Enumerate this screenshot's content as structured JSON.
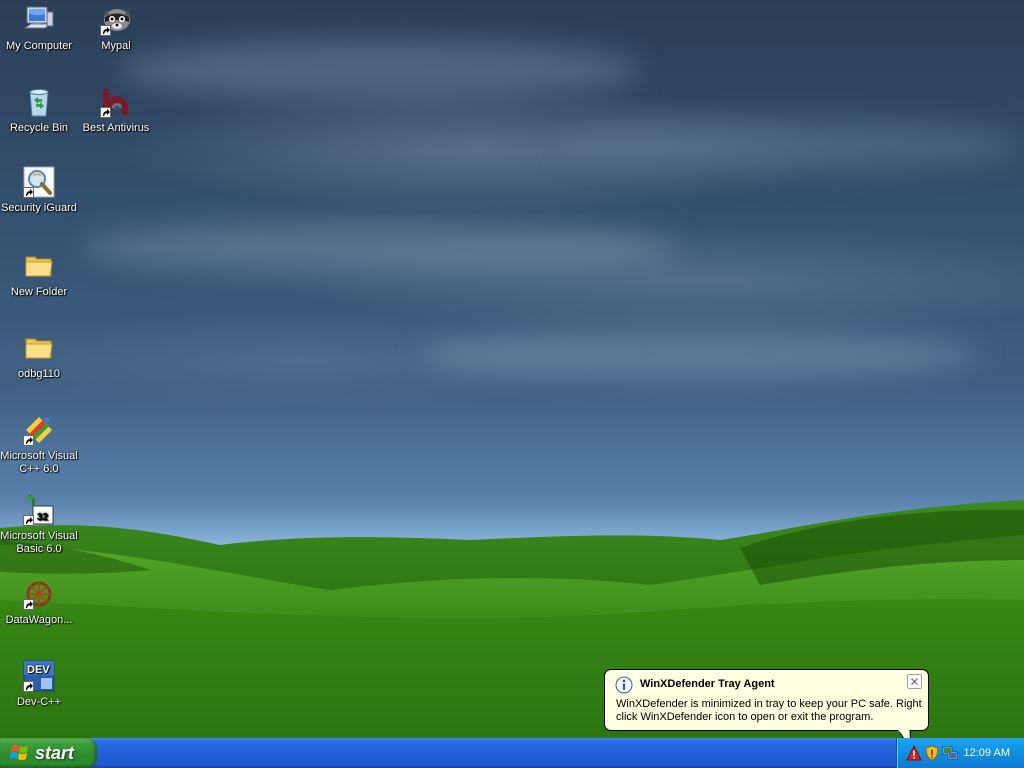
{
  "desktop": {
    "icons": [
      {
        "label": "My Computer",
        "icon": "my-computer-icon"
      },
      {
        "label": "Mypal",
        "icon": "mypal-icon"
      },
      {
        "label": "Recycle Bin",
        "icon": "recycle-bin-icon"
      },
      {
        "label": "Best Antivirus",
        "icon": "best-antivirus-icon"
      },
      {
        "label": "Security iGuard",
        "icon": "security-iguard-icon"
      },
      {
        "label": "New Folder",
        "icon": "folder-icon"
      },
      {
        "label": "odbg110",
        "icon": "folder-icon"
      },
      {
        "label": "Microsoft Visual C++ 6.0",
        "icon": "visual-cpp-icon"
      },
      {
        "label": "Microsoft Visual Basic 6.0",
        "icon": "visual-basic-icon"
      },
      {
        "label": "DataWagon...",
        "icon": "datawagon-icon"
      },
      {
        "label": "Dev-C++",
        "icon": "dev-cpp-icon"
      }
    ]
  },
  "balloon": {
    "title": "WinXDefender Tray Agent",
    "message": "WinXDefender is minimized in tray to keep your PC safe. Right click WinXDefender icon to open or exit the program."
  },
  "taskbar": {
    "start_label": "start",
    "tray_icons": [
      "warning-icon",
      "security-shield-icon",
      "network-icon"
    ],
    "clock": "12:09 AM"
  },
  "colors": {
    "taskbar_blue": "#245edb",
    "start_green": "#3c9c3c",
    "tray_blue": "#0f8ce0",
    "balloon_bg": "#ffffe1"
  }
}
